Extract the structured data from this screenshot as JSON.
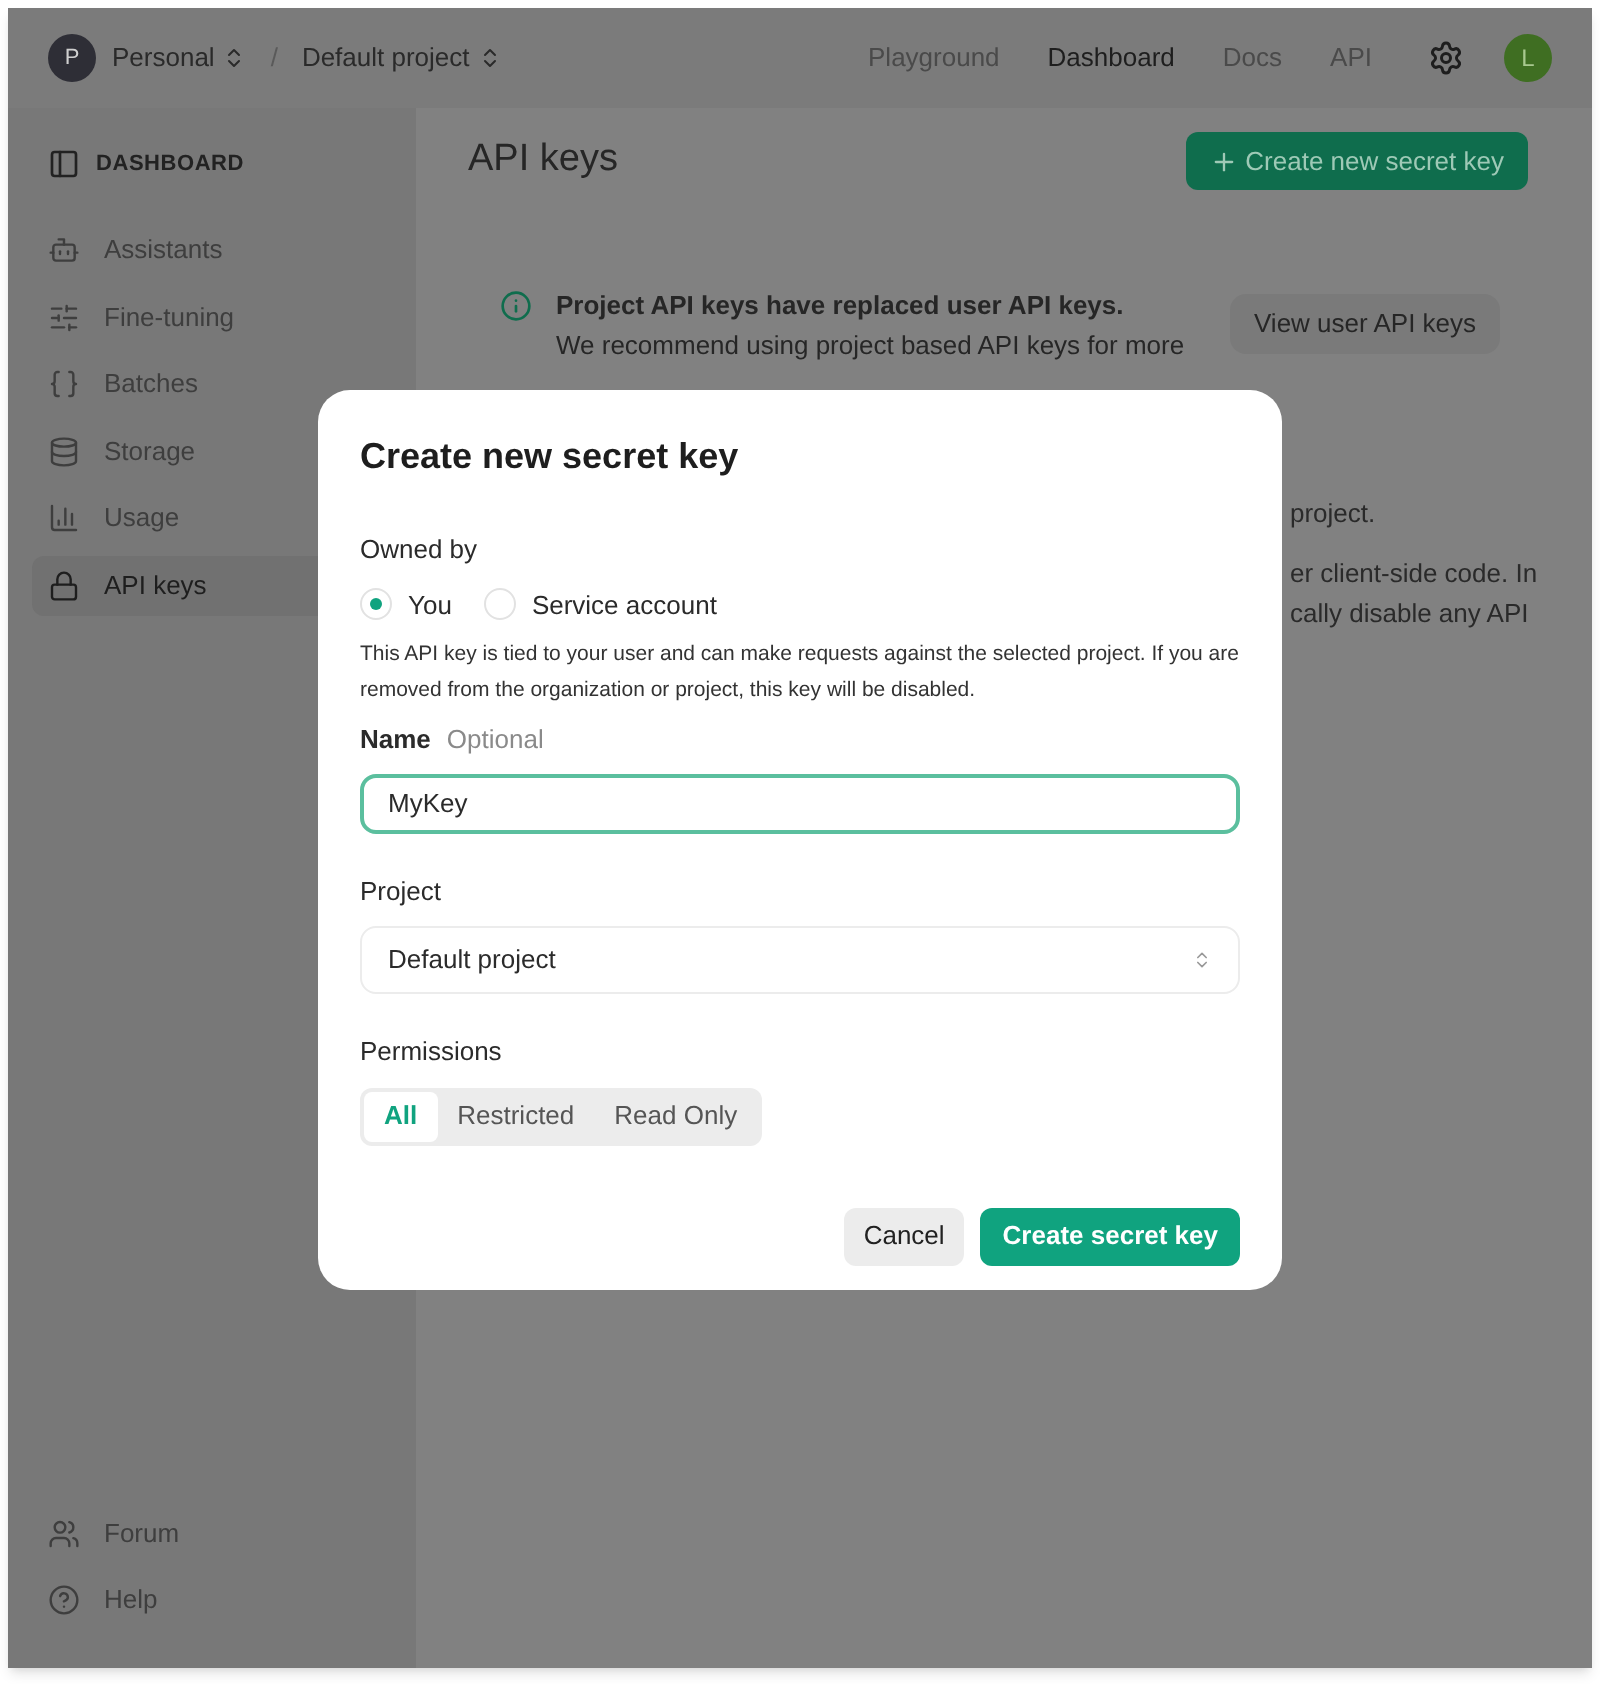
{
  "topbar": {
    "org": {
      "initial": "P",
      "name": "Personal"
    },
    "separator": "/",
    "project": "Default project",
    "nav": [
      {
        "label": "Playground",
        "selected": false
      },
      {
        "label": "Dashboard",
        "selected": true
      },
      {
        "label": "Docs",
        "selected": false
      },
      {
        "label": "API",
        "selected": false
      }
    ],
    "avatar": "L"
  },
  "sidebar": {
    "header": "DASHBOARD",
    "items": [
      {
        "label": "Assistants",
        "selected": false
      },
      {
        "label": "Fine-tuning",
        "selected": false
      },
      {
        "label": "Batches",
        "selected": false
      },
      {
        "label": "Storage",
        "selected": false
      },
      {
        "label": "Usage",
        "selected": false
      },
      {
        "label": "API keys",
        "selected": true
      }
    ],
    "footer": [
      {
        "label": "Forum"
      },
      {
        "label": "Help"
      }
    ]
  },
  "main": {
    "title": "API keys",
    "create_button": "Create new secret key",
    "notice": {
      "title": "Project API keys have replaced user API keys.",
      "body": "We recommend using project based API keys for more",
      "button": "View user API keys"
    },
    "fragments": [
      "project.",
      "er client-side code. In",
      "cally disable any API"
    ]
  },
  "modal": {
    "title": "Create new secret key",
    "owned_by": {
      "label": "Owned by",
      "options": [
        {
          "label": "You",
          "selected": true
        },
        {
          "label": "Service account",
          "selected": false
        }
      ]
    },
    "description": "This API key is tied to your user and can make requests against the selected project. If you are removed from the organization or project, this key will be disabled.",
    "name": {
      "label": "Name",
      "hint": "Optional",
      "value": "MyKey"
    },
    "project": {
      "label": "Project",
      "value": "Default project"
    },
    "permissions": {
      "label": "Permissions",
      "options": [
        {
          "label": "All",
          "selected": true
        },
        {
          "label": "Restricted",
          "selected": false
        },
        {
          "label": "Read Only",
          "selected": false
        }
      ]
    },
    "cancel": "Cancel",
    "submit": "Create secret key"
  }
}
